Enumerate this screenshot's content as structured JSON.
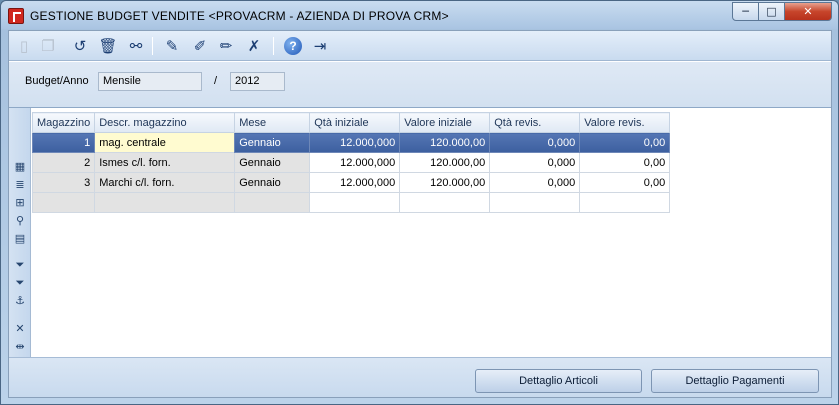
{
  "window": {
    "title": "GESTIONE BUDGET VENDITE <PROVACRM - AZIENDA DI PROVA CRM>",
    "controls": {
      "minimize": "─",
      "maximize": "□",
      "close": "✕"
    }
  },
  "toolbar": {
    "buttons": [
      {
        "icon": "new-doc-icon",
        "glyph": "▯",
        "enabled": false
      },
      {
        "icon": "copy-icon",
        "glyph": "❐",
        "enabled": false
      },
      {
        "icon": "undo-icon",
        "glyph": "↺",
        "enabled": true
      },
      {
        "icon": "trash-icon",
        "glyph": "🗑",
        "enabled": true
      },
      {
        "icon": "binoculars-icon",
        "glyph": "⚯",
        "enabled": true
      },
      {
        "icon": "pencil-edit-icon",
        "glyph": "✎",
        "enabled": true
      },
      {
        "icon": "pencil-check-icon",
        "glyph": "✐",
        "enabled": true
      },
      {
        "icon": "pencil-back-icon",
        "glyph": "✏",
        "enabled": true
      },
      {
        "icon": "pencil-delete-icon",
        "glyph": "✗",
        "enabled": true
      },
      {
        "icon": "help-icon",
        "glyph": "?",
        "enabled": true
      },
      {
        "icon": "exit-door-icon",
        "glyph": "⇥",
        "enabled": true
      }
    ]
  },
  "header": {
    "budget_anno_label": "Budget/Anno",
    "budget_type": "Mensile",
    "separator": "/",
    "year": "2012"
  },
  "side_tools": [
    {
      "icon": "grid-add-icon",
      "glyph": "▦"
    },
    {
      "icon": "list-icon",
      "glyph": "≣"
    },
    {
      "icon": "insert-row-icon",
      "glyph": "⊞"
    },
    {
      "icon": "zoom-icon",
      "glyph": "⚲"
    },
    {
      "icon": "columns-icon",
      "glyph": "▤"
    },
    {
      "icon": "filter-icon",
      "glyph": "⏷"
    },
    {
      "icon": "filter-clear-icon",
      "glyph": "⏷"
    },
    {
      "icon": "anchor-icon",
      "glyph": "⚓"
    },
    {
      "icon": "delete-col-icon",
      "glyph": "✕"
    },
    {
      "icon": "resize-col-icon",
      "glyph": "⇹"
    }
  ],
  "grid": {
    "columns": [
      "Magazzino",
      "Descr. magazzino",
      "Mese",
      "Qtà iniziale",
      "Valore iniziale",
      "Qtà revis.",
      "Valore revis."
    ],
    "rows": [
      [
        "1",
        "mag. centrale",
        "Gennaio",
        "12.000,000",
        "120.000,00",
        "0,000",
        "0,00"
      ],
      [
        "2",
        "Ismes c/l. forn.",
        "Gennaio",
        "12.000,000",
        "120.000,00",
        "0,000",
        "0,00"
      ],
      [
        "3",
        "Marchi c/l. forn.",
        "Gennaio",
        "12.000,000",
        "120.000,00",
        "0,000",
        "0,00"
      ]
    ],
    "selected_row": 0
  },
  "buttons": {
    "dettaglio_articoli": "Dettaglio Articoli",
    "dettaglio_pagamenti": "Dettaglio Pagamenti"
  }
}
